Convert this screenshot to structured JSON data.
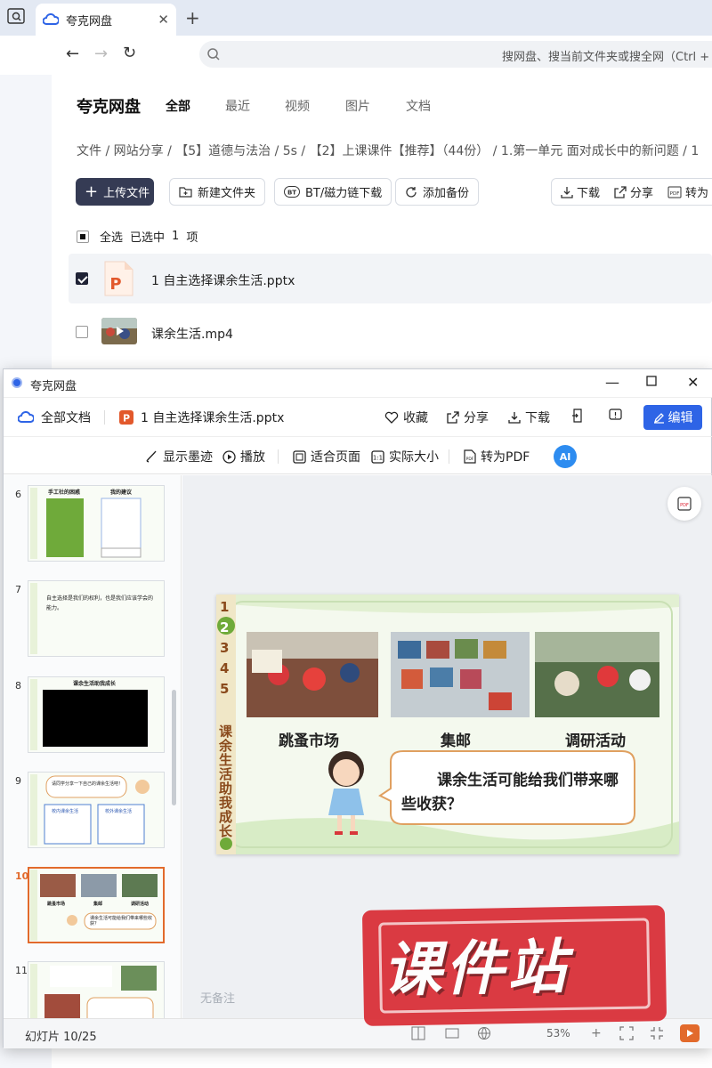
{
  "browser": {
    "tab_title": "夸克网盘",
    "address_placeholder": "搜网盘、搜当前文件夹或搜全网（Ctrl + F"
  },
  "drive": {
    "brand": "夸克网盘",
    "filter_tabs": [
      "全部",
      "最近",
      "视频",
      "图片",
      "文档"
    ],
    "breadcrumb": "文件 / 网站分享 / 【5】道德与法治 / 5s / 【2】上课课件【推荐】（44份） / 1.第一单元 面对成长中的新问题 / 1",
    "toolbar": {
      "upload": "上传文件",
      "new_folder": "新建文件夹",
      "bt": "BT/磁力链下载",
      "backup": "添加备份",
      "download": "下载",
      "share": "分享",
      "to_pdf": "转为"
    },
    "selection": {
      "select_all": "全选",
      "selected": "已选中",
      "count": "1",
      "unit": "项"
    },
    "files": [
      {
        "name": "1 自主选择课余生活.pptx",
        "checked": true
      },
      {
        "name": "课余生活.mp4",
        "checked": false
      }
    ]
  },
  "viewer": {
    "window_title": "夸克网盘",
    "all_docs": "全部文档",
    "file_name": "1 自主选择课余生活.pptx",
    "actions": {
      "favorite": "收藏",
      "share": "分享",
      "download": "下载",
      "edit": "编辑"
    },
    "tools": {
      "ink": "显示墨迹",
      "play": "播放",
      "fit": "适合页面",
      "actual": "实际大小",
      "to_pdf": "转为PDF",
      "ai": "AI"
    },
    "thumbnails": [
      {
        "num": "6",
        "title_left": "手工社的困惑",
        "title_right": "我的建议"
      },
      {
        "num": "7",
        "text": "自主选择是我们的权利，也是我们应该学会的能力。"
      },
      {
        "num": "8",
        "title": "课余生活助我成长"
      },
      {
        "num": "9",
        "text": "请同学分享一下自己的课余生活吧！",
        "box_left": "校内课余生活",
        "box_right": "校外课余生活"
      },
      {
        "num": "10",
        "active": true,
        "labels": [
          "跳蚤市场",
          "集邮",
          "调研活动"
        ],
        "bubble": "课余生活可能给我们带来哪些收获？"
      },
      {
        "num": "11"
      }
    ],
    "slide": {
      "side_numbers": [
        "1",
        "2",
        "3",
        "4",
        "5"
      ],
      "side_title": "课余生活助我成长",
      "photo_labels": [
        "跳蚤市场",
        "集邮",
        "调研活动"
      ],
      "bubble_text": "课余生活可能给我们带来哪些收获？"
    },
    "notes_placeholder": "无备注",
    "status": {
      "slide_count": "幻灯片 10/25",
      "zoom": "53%"
    },
    "watermark": "课件站"
  },
  "colors": {
    "primary": "#2e64e6",
    "upload_btn": "#353b54",
    "accent_orange": "#e26a2c",
    "watermark_red": "#d8272f"
  }
}
